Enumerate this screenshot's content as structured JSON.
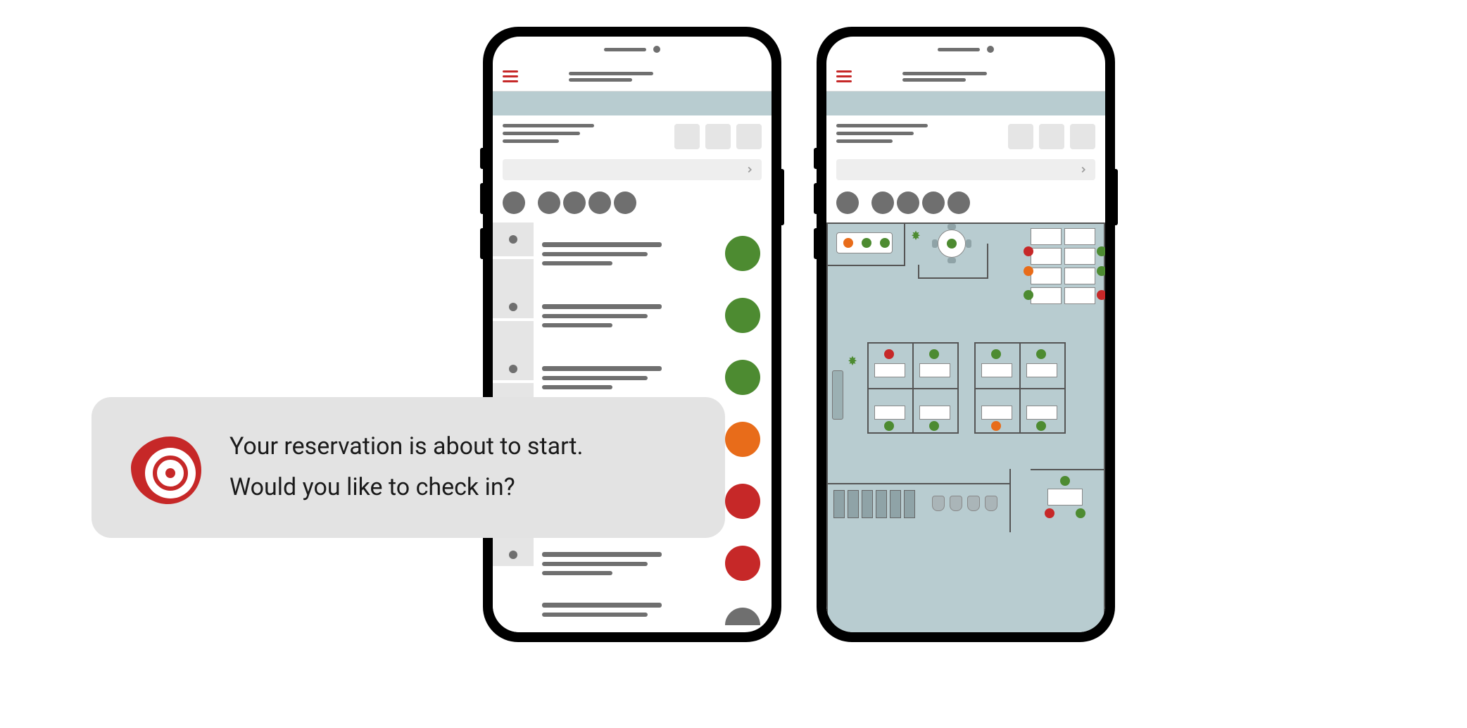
{
  "notification": {
    "line1": "Your reservation is about to start.",
    "line2": "Would you like to check in?"
  },
  "colors": {
    "accent_red": "#c62828",
    "status_green": "#4d8b31",
    "status_orange": "#e86c1a",
    "status_red": "#c62828",
    "banner": "#b8ccd0"
  },
  "list_view": {
    "items": [
      {
        "status": "green"
      },
      {
        "status": "green"
      },
      {
        "status": "green"
      },
      {
        "status": "orange"
      },
      {
        "status": "red"
      },
      {
        "status": "red"
      },
      {
        "status": "half"
      }
    ]
  },
  "floorplan": {
    "seats": [
      {
        "status": "orange"
      },
      {
        "status": "green"
      },
      {
        "status": "green"
      },
      {
        "status": "red"
      },
      {
        "status": "green"
      },
      {
        "status": "orange"
      },
      {
        "status": "green"
      },
      {
        "status": "red"
      },
      {
        "status": "red"
      },
      {
        "status": "green"
      },
      {
        "status": "green"
      },
      {
        "status": "green"
      },
      {
        "status": "green"
      },
      {
        "status": "orange"
      },
      {
        "status": "green"
      },
      {
        "status": "green"
      },
      {
        "status": "red"
      }
    ]
  }
}
